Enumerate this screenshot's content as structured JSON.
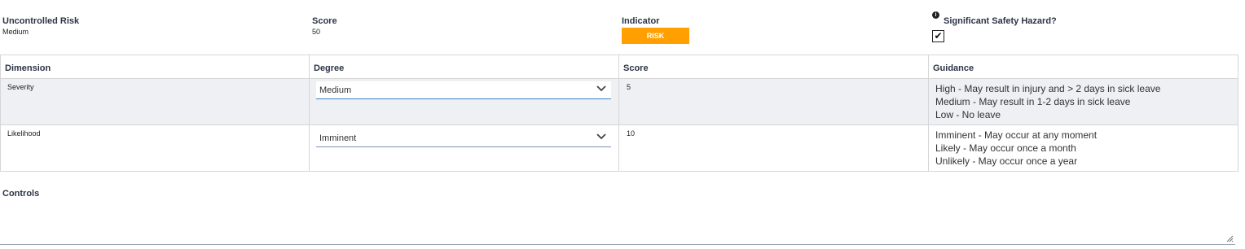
{
  "summary": {
    "uncontrolled_risk_label": "Uncontrolled Risk",
    "uncontrolled_risk_value": "Medium",
    "score_label": "Score",
    "score_value": "50",
    "indicator_label": "Indicator",
    "indicator_value": "RISK",
    "indicator_color": "#ff9f00",
    "hazard_label": "Significant Safety Hazard?",
    "hazard_checked": true,
    "info_icon": "info-icon"
  },
  "table": {
    "headers": [
      "Dimension",
      "Degree",
      "Score",
      "Guidance"
    ],
    "rows": [
      {
        "dimension": "Severity",
        "degree": "Medium",
        "score": "5",
        "guidance": [
          "High - May result in injury and > 2 days in sick leave",
          "Medium - May result in 1-2 days in sick leave",
          "Low - No leave"
        ]
      },
      {
        "dimension": "Likelihood",
        "degree": "Imminent",
        "score": "10",
        "guidance": [
          "Imminent - May occur at any moment",
          "Likely - May occur once a month",
          "Unlikely - May occur once a year"
        ]
      }
    ]
  },
  "controls": {
    "label": "Controls",
    "value": ""
  }
}
